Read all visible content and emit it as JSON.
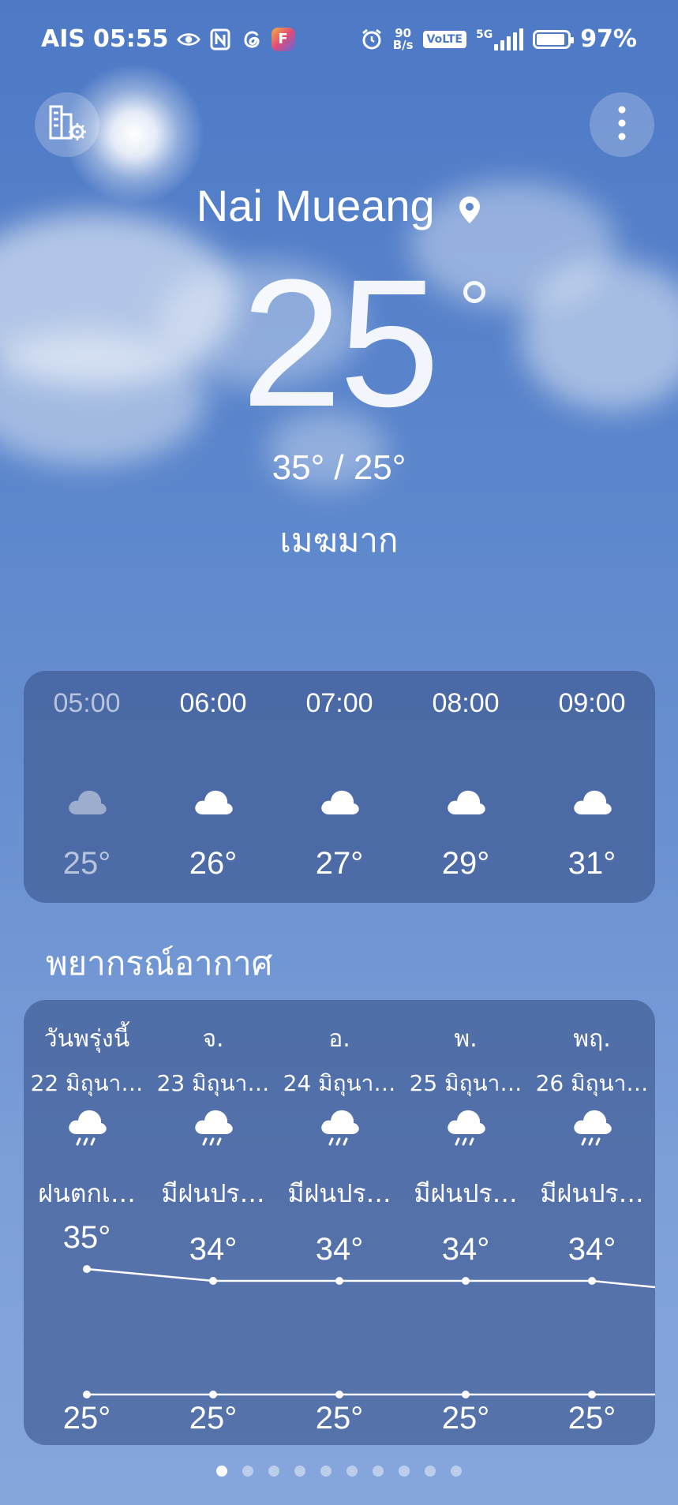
{
  "status_bar": {
    "carrier": "AIS",
    "time": "05:55",
    "net_speed_value": "90",
    "net_speed_unit": "B/s",
    "volte": "VoLTE",
    "network": "5G",
    "battery": "97%",
    "battery_level": 0.97
  },
  "location": {
    "name": "Nai Mueang"
  },
  "current": {
    "temp": "25",
    "hilo": "35° / 25°",
    "condition": "เมฆมาก"
  },
  "hourly": [
    {
      "time": "05:00",
      "temp": "25°",
      "current": true
    },
    {
      "time": "06:00",
      "temp": "26°"
    },
    {
      "time": "07:00",
      "temp": "27°"
    },
    {
      "time": "08:00",
      "temp": "29°"
    },
    {
      "time": "09:00",
      "temp": "31°"
    }
  ],
  "forecast": {
    "title": "พยากรณ์อากาศ",
    "days": [
      {
        "day": "วันพรุ่งนี้",
        "date": "22 มิถุนา…",
        "condition": "ฝนตกเ…",
        "high": "35°",
        "low": "25°",
        "high_value": 35,
        "low_value": 25
      },
      {
        "day": "จ.",
        "date": "23 มิถุนา…",
        "condition": "มีฝนปร…",
        "high": "34°",
        "low": "25°",
        "high_value": 34,
        "low_value": 25
      },
      {
        "day": "อ.",
        "date": "24 มิถุนา…",
        "condition": "มีฝนปร…",
        "high": "34°",
        "low": "25°",
        "high_value": 34,
        "low_value": 25
      },
      {
        "day": "พ.",
        "date": "25 มิถุนา…",
        "condition": "มีฝนปร…",
        "high": "34°",
        "low": "25°",
        "high_value": 34,
        "low_value": 25
      },
      {
        "day": "พฤ.",
        "date": "26 มิถุนา…",
        "condition": "มีฝนปร…",
        "high": "34°",
        "low": "25°",
        "high_value": 34,
        "low_value": 25
      }
    ]
  },
  "pager": {
    "count": 10,
    "active": 0
  },
  "icons": {
    "city_manage": "city-settings-icon",
    "more": "more-vertical-icon",
    "location": "location-pin-icon",
    "cloudy": "cloud-icon",
    "rain": "rain-cloud-icon"
  }
}
